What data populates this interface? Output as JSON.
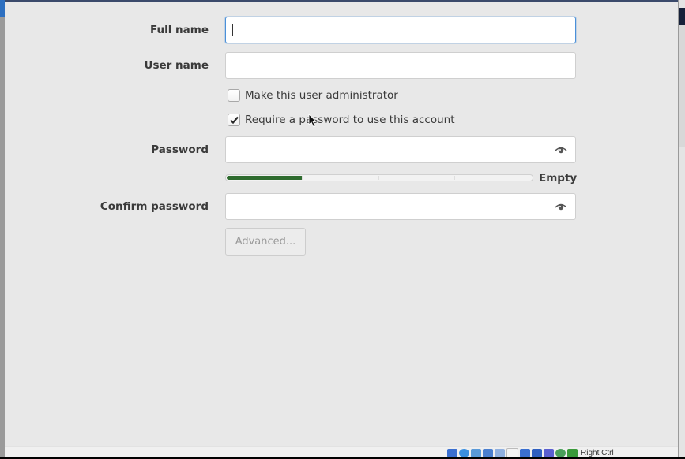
{
  "form": {
    "full_name": {
      "label": "Full name",
      "value": "",
      "focused": true
    },
    "user_name": {
      "label": "User name",
      "value": ""
    },
    "administrator": {
      "label": "Make this user administrator",
      "checked": false
    },
    "require_password": {
      "label": "Require a password to use this account",
      "checked": true
    },
    "password": {
      "label": "Password",
      "value": "",
      "reveal_icon": "eye-icon"
    },
    "strength": {
      "label": "Empty",
      "level_fraction": 0.25,
      "segments": 4,
      "fill_color": "#2e6b2e"
    },
    "confirm_password": {
      "label": "Confirm password",
      "value": "",
      "reveal_icon": "eye-icon"
    },
    "advanced_button": {
      "label": "Advanced...",
      "enabled": false
    }
  },
  "statusbar": {
    "host_key": "Right Ctrl",
    "icons": [
      "hard-disk-icon",
      "optical-drive-icon",
      "audio-icon",
      "network-icon",
      "usb-icon",
      "shared-folders-icon",
      "display-icon",
      "video-capture-icon",
      "recording-icon",
      "cpu-icon",
      "mouse-integration-icon",
      "keyboard-icon"
    ]
  },
  "colors": {
    "focus": "#4a90d9",
    "dialog_bg": "#e8e8e8"
  }
}
